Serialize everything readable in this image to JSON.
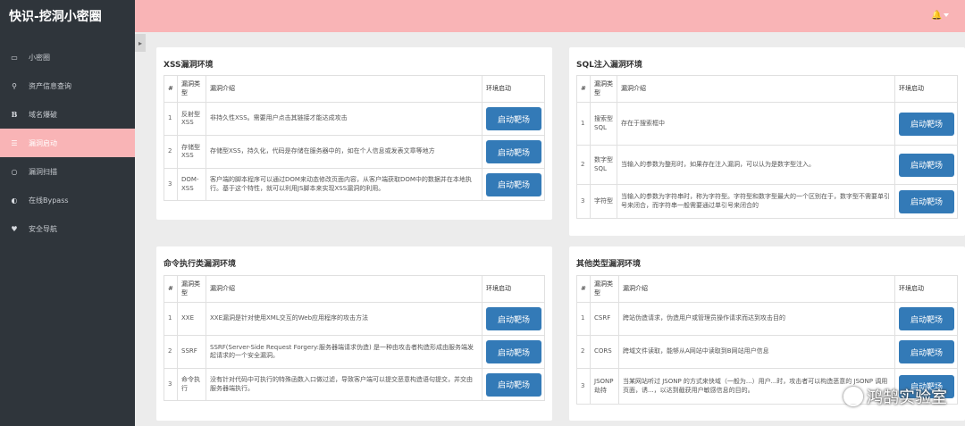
{
  "brand": "快识-挖洞小密圈",
  "sidebar": {
    "items": [
      {
        "label": "小密圈",
        "icon": "monitor-icon",
        "glyph": "▭",
        "active": false
      },
      {
        "label": "资产信息查询",
        "icon": "search-icon",
        "glyph": "⚲",
        "active": false
      },
      {
        "label": "域名爆破",
        "icon": "bold-b-icon",
        "glyph": "B",
        "active": false
      },
      {
        "label": "漏洞启动",
        "icon": "list-icon",
        "glyph": "☰",
        "active": true
      },
      {
        "label": "漏洞扫描",
        "icon": "circle-icon",
        "glyph": "○",
        "active": false
      },
      {
        "label": "在线Bypass",
        "icon": "drop-icon",
        "glyph": "◐",
        "active": false
      },
      {
        "label": "安全导航",
        "icon": "heart-icon",
        "glyph": "♥",
        "active": false
      }
    ]
  },
  "topbar": {
    "bell_glyph": "🔔"
  },
  "toggle_glyph": "▸",
  "table_headers": {
    "num": "#",
    "type": "漏洞类型",
    "desc": "漏洞介绍",
    "action": "环境启动"
  },
  "button_label": "启动靶场",
  "panels": {
    "xss": {
      "title": "XSS漏洞环境",
      "rows": [
        {
          "num": "1",
          "type": "反射型XSS",
          "desc": "非持久性XSS。需要用户点击其链接才能达成攻击"
        },
        {
          "num": "2",
          "type": "存储型XSS",
          "desc": "存储型XSS，持久化，代码是存储在服务器中的，如在个人信息或发表文章等地方"
        },
        {
          "num": "3",
          "type": "DOM-XSS",
          "desc": "客户端的脚本程序可以通过DOM来动态修改页面内容，从客户端获取DOM中的数据并在本地执行。基于这个特性，就可以利用JS脚本来实现XSS漏洞的利用。"
        }
      ]
    },
    "sql": {
      "title": "SQL注入漏洞环境",
      "rows": [
        {
          "num": "1",
          "type": "搜索型SQL",
          "desc": "存在于搜索框中"
        },
        {
          "num": "2",
          "type": "数字型SQL",
          "desc": "当输入的参数为整形时，如果存在注入漏洞，可以认为是数字型注入。"
        },
        {
          "num": "3",
          "type": "字符型",
          "desc": "当输入的参数为字符串时，称为字符型。字符型和数字型最大的一个区别在于，数字型不需要单引号来闭合，而字符串一般需要通过单引号来闭合的"
        }
      ]
    },
    "cmd": {
      "title": "命令执行类漏洞环境",
      "rows": [
        {
          "num": "1",
          "type": "XXE",
          "desc": "XXE漏洞是针对使用XML交互的Web应用程序的攻击方法"
        },
        {
          "num": "2",
          "type": "SSRF",
          "desc": "SSRF(Server-Side Request Forgery:服务器端请求伪造) 是一种由攻击者构造形成由服务端发起请求的一个安全漏洞。"
        },
        {
          "num": "3",
          "type": "命令执行",
          "desc": "没有针对代码中可执行的特殊函数入口做过滤，导致客户端可以提交恶意构造语句提交，并交由服务器端执行。"
        }
      ]
    },
    "other": {
      "title": "其他类型漏洞环境",
      "rows": [
        {
          "num": "1",
          "type": "CSRF",
          "desc": "跨站伪造请求，伪造用户或管理员操作请求而达到攻击目的"
        },
        {
          "num": "2",
          "type": "CORS",
          "desc": "跨域文件读取，能够从A网站中读取到B网站用户信息"
        },
        {
          "num": "3",
          "type": "JSONP劫持",
          "desc": "当某网站听过 JSONP 的方式来快域（一般为...）用户...时，攻击者可以构造恶意的 JSONP 调用页面，诱...，以达到截获用户敏感信息的目的。"
        }
      ]
    }
  },
  "watermark": "鸿鹄实验室"
}
